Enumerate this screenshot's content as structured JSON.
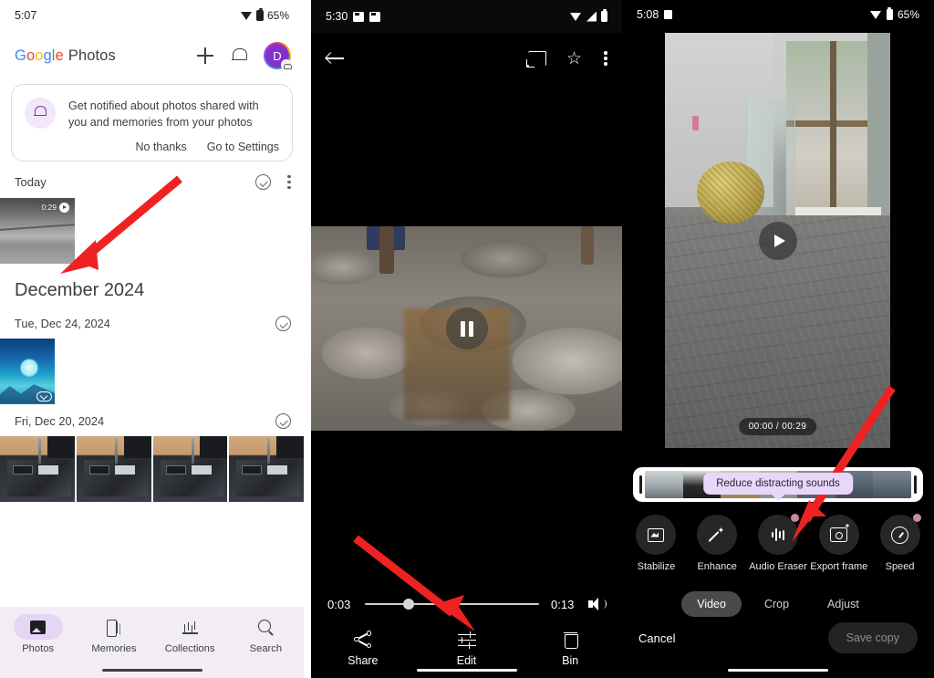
{
  "panel1": {
    "status_bar": {
      "time": "5:07",
      "battery": "65%",
      "wifi_icon": "wifi-icon",
      "battery_icon": "battery-icon"
    },
    "header": {
      "logo_google": [
        "G",
        "o",
        "o",
        "g",
        "l",
        "e"
      ],
      "logo_product": "Photos",
      "add_icon": "plus-icon",
      "notifications_icon": "bell-icon",
      "avatar_initial": "D"
    },
    "notification_card": {
      "icon": "bell-notification-icon",
      "message": "Get notified about photos shared with you and memories from your photos",
      "dismiss_label": "No thanks",
      "settings_label": "Go to Settings"
    },
    "sections": [
      {
        "title": "Today",
        "type": "small",
        "select_icon": "check-circle-icon",
        "overflow_icon": "more-vertical-icon"
      }
    ],
    "month_header": "December 2024",
    "date_groups": [
      {
        "label": "Tue, Dec 24, 2024",
        "select_icon": "check-circle-icon"
      },
      {
        "label": "Fri, Dec 20, 2024",
        "select_icon": "check-circle-icon"
      }
    ],
    "video_thumb": {
      "duration": "0:29",
      "play_icon": "play-circle-icon"
    },
    "bottom_nav": [
      {
        "label": "Photos",
        "icon": "photos-icon",
        "active": true
      },
      {
        "label": "Memories",
        "icon": "memories-icon",
        "active": false
      },
      {
        "label": "Collections",
        "icon": "collections-icon",
        "active": false
      },
      {
        "label": "Search",
        "icon": "search-icon",
        "active": false
      }
    ]
  },
  "panel2": {
    "status_bar": {
      "time": "5:30",
      "notif_icon_1": "notification-icon",
      "notif_icon_2": "notification-icon",
      "wifi_icon": "wifi-icon",
      "signal_icon": "signal-icon",
      "battery_icon": "battery-icon"
    },
    "toolbar": {
      "back_icon": "back-arrow-icon",
      "cast_icon": "cast-icon",
      "favorite_icon": "star-icon",
      "overflow_icon": "more-vertical-icon"
    },
    "player": {
      "pause_icon": "pause-icon",
      "current_time": "0:03",
      "total_time": "0:13",
      "progress_percent": 25,
      "volume_icon": "volume-icon"
    },
    "actions": [
      {
        "label": "Share",
        "icon": "share-icon"
      },
      {
        "label": "Edit",
        "icon": "edit-sliders-icon"
      },
      {
        "label": "Bin",
        "icon": "trash-icon"
      }
    ]
  },
  "panel3": {
    "status_bar": {
      "time": "5:08",
      "battery": "65%",
      "mini_icon": "notification-icon",
      "wifi_icon": "wifi-icon",
      "battery_icon": "battery-icon"
    },
    "preview": {
      "play_icon": "play-circle-icon",
      "timecode": "00:00 / 00:29"
    },
    "timeline": {
      "tooltip": "Reduce distracting sounds",
      "left_handle": "trim-handle",
      "right_handle": "trim-handle"
    },
    "tools": [
      {
        "label": "Stabilize",
        "icon": "stabilize-icon",
        "badge": false
      },
      {
        "label": "Enhance",
        "icon": "enhance-wand-icon",
        "badge": false
      },
      {
        "label": "Audio Eraser",
        "icon": "audio-waveform-icon",
        "badge": true
      },
      {
        "label": "Export frame",
        "icon": "export-frame-icon",
        "badge": false
      },
      {
        "label": "Speed",
        "icon": "speed-gauge-icon",
        "badge": true
      }
    ],
    "mode_tabs": [
      {
        "label": "Video",
        "active": true
      },
      {
        "label": "Crop",
        "active": false
      },
      {
        "label": "Adjust",
        "active": false
      }
    ],
    "footer": {
      "cancel_label": "Cancel",
      "save_label": "Save copy"
    }
  },
  "annotations": {
    "arrow_color": "#ee2222",
    "arrow_count": 3
  }
}
